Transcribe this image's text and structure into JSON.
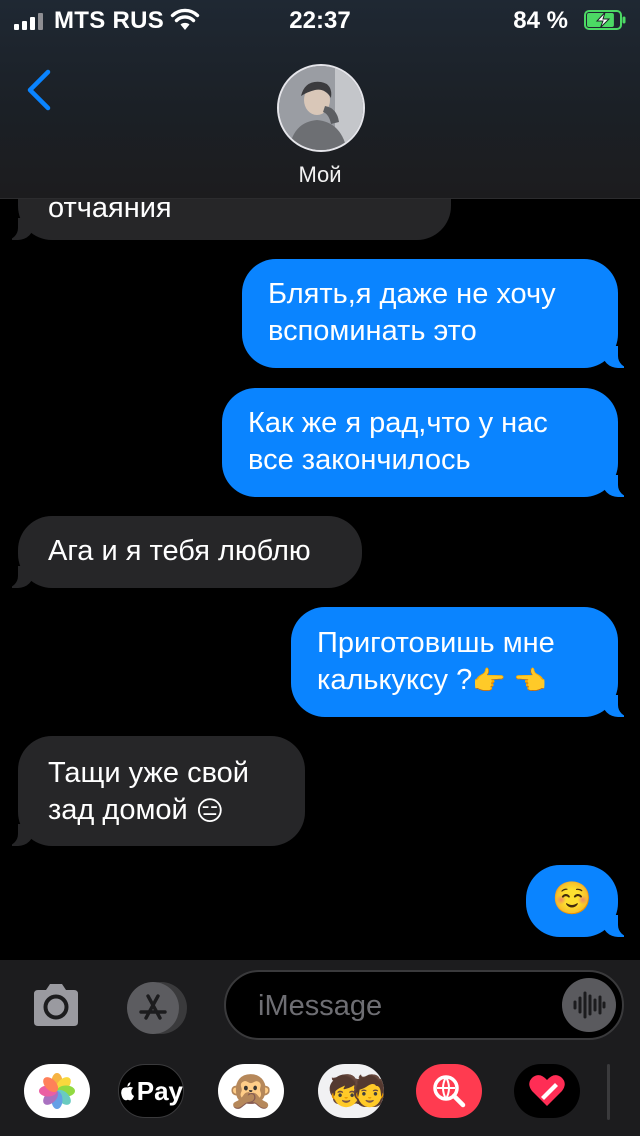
{
  "status_bar": {
    "carrier": "MTS RUS",
    "time": "22:37",
    "battery_percent": "84 %",
    "battery_level": 0.84,
    "battery_charging": true
  },
  "header": {
    "back_icon": "chevron-left-icon",
    "contact_name": "Мой",
    "accent_color": "#0a84ff"
  },
  "messages": [
    {
      "direction": "incoming",
      "text": "отчаяния"
    },
    {
      "direction": "outgoing",
      "lines": [
        "Блять,я даже не хочу",
        "вспоминать это"
      ]
    },
    {
      "direction": "outgoing",
      "lines": [
        "Как же я рад,что у нас",
        "все закончилось"
      ]
    },
    {
      "direction": "incoming",
      "text": "Ага и я тебя люблю"
    },
    {
      "direction": "outgoing",
      "lines": [
        "Приготовишь мне",
        "калькуксу ?"
      ],
      "emoji": "👉 👈"
    },
    {
      "direction": "incoming",
      "lines": [
        "Тащи уже свой",
        "зад домой"
      ],
      "emoji": "😑"
    },
    {
      "direction": "outgoing",
      "emoji": "☺️"
    }
  ],
  "composer": {
    "placeholder": "iMessage",
    "camera_icon": "camera-icon",
    "appstore_icon": "app-store-icon",
    "voice_icon": "audio-waveform-icon"
  },
  "app_drawer": {
    "apple_pay_label": "Pay",
    "apps": [
      "photos-icon",
      "apple-pay-icon",
      "animoji-icon",
      "memoji-icon",
      "web-search-icon",
      "digital-touch-icon"
    ],
    "animoji_glyph": "🙊",
    "memoji_glyph": "🧒🧑"
  },
  "colors": {
    "incoming_bubble": "#262628",
    "outgoing_bubble": "#0a84ff",
    "battery_charging": "#4cd964"
  }
}
